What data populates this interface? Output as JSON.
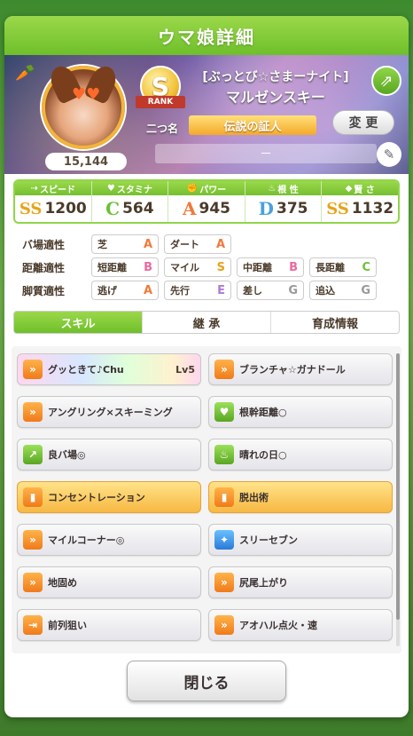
{
  "title": "ウマ娘詳細",
  "profile": {
    "fans": "15,144",
    "rank": "S",
    "rank_ribbon": "RANK",
    "nickname": "二つ名",
    "outfit": "[ぶっとび☆さまーナイト]",
    "name": "マルゼンスキー",
    "title_badge": "伝説の証人",
    "change_label": "変 更",
    "memo": "－",
    "share_icon": "share-icon",
    "edit_icon": "pencil-icon",
    "carrot_icon": "carrot-icon"
  },
  "stats": [
    {
      "label": "スピード",
      "grade": "SS",
      "value": "1200"
    },
    {
      "label": "スタミナ",
      "grade": "C",
      "value": "564"
    },
    {
      "label": "パワー",
      "grade": "A",
      "value": "945"
    },
    {
      "label": "根 性",
      "grade": "D",
      "value": "375"
    },
    {
      "label": "賢 さ",
      "grade": "SS",
      "value": "1132"
    }
  ],
  "aptitudes": {
    "track": {
      "label": "バ場適性",
      "items": [
        {
          "name": "芝",
          "grade": "A"
        },
        {
          "name": "ダート",
          "grade": "A"
        }
      ]
    },
    "distance": {
      "label": "距離適性",
      "items": [
        {
          "name": "短距離",
          "grade": "B"
        },
        {
          "name": "マイル",
          "grade": "S"
        },
        {
          "name": "中距離",
          "grade": "B"
        },
        {
          "name": "長距離",
          "grade": "C"
        }
      ]
    },
    "style": {
      "label": "脚質適性",
      "items": [
        {
          "name": "逃げ",
          "grade": "A"
        },
        {
          "name": "先行",
          "grade": "E"
        },
        {
          "name": "差し",
          "grade": "G"
        },
        {
          "name": "追込",
          "grade": "G"
        }
      ]
    }
  },
  "tabs": [
    "スキル",
    "継 承",
    "育成情報"
  ],
  "skills": [
    {
      "name": "グッときて♪Chu",
      "level": "Lv5"
    },
    {
      "name": "ブランチャ☆ガナドール",
      "level": ""
    },
    {
      "name": "アングリング×スキーミング",
      "level": ""
    },
    {
      "name": "根幹距離○",
      "level": ""
    },
    {
      "name": "良バ場◎",
      "level": ""
    },
    {
      "name": "晴れの日○",
      "level": ""
    },
    {
      "name": "コンセントレーション",
      "level": ""
    },
    {
      "name": "脱出術",
      "level": ""
    },
    {
      "name": "マイルコーナー◎",
      "level": ""
    },
    {
      "name": "スリーセブン",
      "level": ""
    },
    {
      "name": "地固め",
      "level": ""
    },
    {
      "name": "尻尾上がり",
      "level": ""
    },
    {
      "name": "前列狙い",
      "level": ""
    },
    {
      "name": "アオハル点火・速",
      "level": ""
    }
  ],
  "close_label": "閉じる"
}
